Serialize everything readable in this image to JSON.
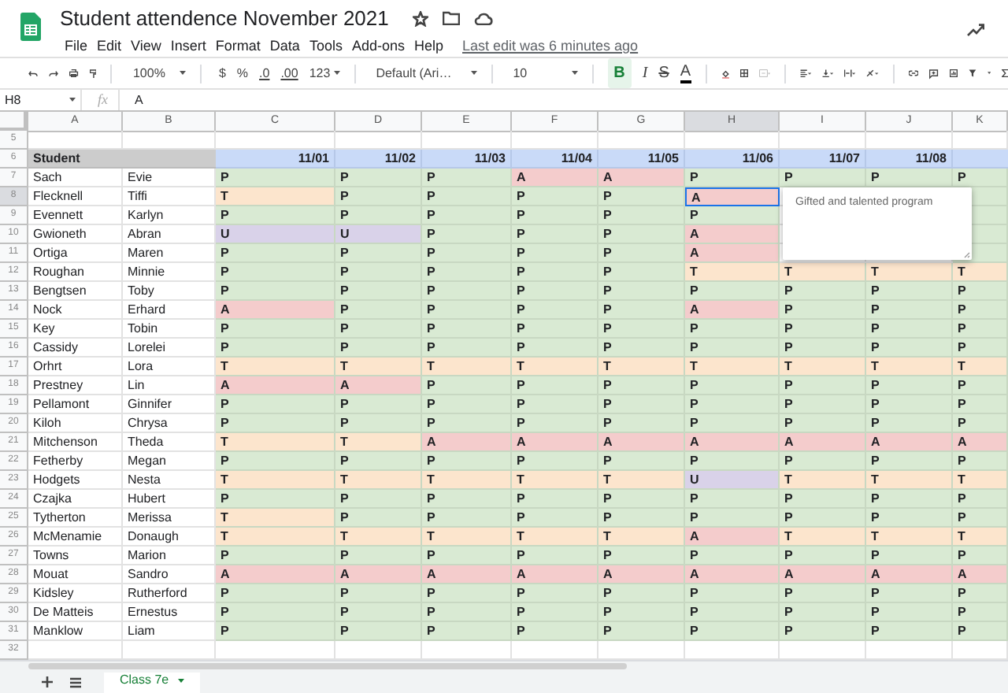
{
  "title": "Student attendence November 2021",
  "menu": [
    "File",
    "Edit",
    "View",
    "Insert",
    "Format",
    "Data",
    "Tools",
    "Add-ons",
    "Help"
  ],
  "last_edit": "Last edit was 6 minutes ago",
  "toolbar": {
    "zoom": "100%",
    "currency": "$",
    "percent": "%",
    "decrease_decimals": ".0",
    "increase_decimals": ".00",
    "number_format": "123",
    "font": "Default (Ari…",
    "font_size": "10",
    "bold": {
      "label": "B",
      "selected": true
    },
    "italic": "I",
    "strikethrough": "S",
    "text_color": "A"
  },
  "formula_bar": {
    "cell": "H8",
    "fx": "fx",
    "value": "A"
  },
  "columns": [
    {
      "label": "A",
      "selected": false
    },
    {
      "label": "B",
      "selected": false
    },
    {
      "label": "C",
      "selected": false
    },
    {
      "label": "D",
      "selected": false
    },
    {
      "label": "E",
      "selected": false
    },
    {
      "label": "F",
      "selected": false
    },
    {
      "label": "G",
      "selected": false
    },
    {
      "label": "H",
      "selected": true
    },
    {
      "label": "I",
      "selected": false
    },
    {
      "label": "J",
      "selected": false
    },
    {
      "label": "K",
      "selected": false
    }
  ],
  "rows": [
    {
      "kind": "blank",
      "number": "5",
      "selected": false
    },
    {
      "kind": "header",
      "number": "6",
      "selected": false,
      "label": "Student",
      "dates": [
        "11/01",
        "11/02",
        "11/03",
        "11/04",
        "11/05",
        "11/06",
        "11/07",
        "11/08"
      ]
    },
    {
      "kind": "student",
      "number": "7",
      "selected": false,
      "last": "Sach",
      "first": "Evie",
      "cells": [
        {
          "value": "P",
          "kind": "present"
        },
        {
          "value": "P",
          "kind": "present"
        },
        {
          "value": "P",
          "kind": "present"
        },
        {
          "value": "A",
          "kind": "absent"
        },
        {
          "value": "A",
          "kind": "absent"
        },
        {
          "value": "P",
          "kind": "present"
        },
        {
          "value": "P",
          "kind": "present"
        },
        {
          "value": "P",
          "kind": "present"
        },
        {
          "value": "P",
          "kind": "present"
        }
      ]
    },
    {
      "kind": "student",
      "number": "8",
      "selected": true,
      "last": "Flecknell",
      "first": "Tiffi",
      "cells": [
        {
          "value": "T",
          "kind": "tardy"
        },
        {
          "value": "P",
          "kind": "present"
        },
        {
          "value": "P",
          "kind": "present"
        },
        {
          "value": "P",
          "kind": "present"
        },
        {
          "value": "P",
          "kind": "present"
        },
        {
          "value": "A",
          "kind": "absent"
        },
        null,
        null,
        {
          "kind": "present"
        }
      ]
    },
    {
      "kind": "student",
      "number": "9",
      "selected": false,
      "last": "Evennett",
      "first": "Karlyn",
      "cells": [
        {
          "value": "P",
          "kind": "present"
        },
        {
          "value": "P",
          "kind": "present"
        },
        {
          "value": "P",
          "kind": "present"
        },
        {
          "value": "P",
          "kind": "present"
        },
        {
          "value": "P",
          "kind": "present"
        },
        {
          "value": "P",
          "kind": "present"
        },
        null,
        null,
        {
          "kind": "present"
        }
      ]
    },
    {
      "kind": "student",
      "number": "10",
      "selected": false,
      "last": "Gwioneth",
      "first": "Abran",
      "cells": [
        {
          "value": "U",
          "kind": "unexcused"
        },
        {
          "value": "U",
          "kind": "unexcused"
        },
        {
          "value": "P",
          "kind": "present"
        },
        {
          "value": "P",
          "kind": "present"
        },
        {
          "value": "P",
          "kind": "present"
        },
        {
          "value": "A",
          "kind": "absent"
        },
        null,
        null,
        {
          "kind": "present"
        }
      ]
    },
    {
      "kind": "student",
      "number": "11",
      "selected": false,
      "last": "Ortiga",
      "first": "Maren",
      "cells": [
        {
          "value": "P",
          "kind": "present"
        },
        {
          "value": "P",
          "kind": "present"
        },
        {
          "value": "P",
          "kind": "present"
        },
        {
          "value": "P",
          "kind": "present"
        },
        {
          "value": "P",
          "kind": "present"
        },
        {
          "value": "A",
          "kind": "absent"
        },
        null,
        null,
        {
          "kind": "present"
        }
      ]
    },
    {
      "kind": "student",
      "number": "12",
      "selected": false,
      "last": "Roughan",
      "first": "Minnie",
      "cells": [
        {
          "value": "P",
          "kind": "present"
        },
        {
          "value": "P",
          "kind": "present"
        },
        {
          "value": "P",
          "kind": "present"
        },
        {
          "value": "P",
          "kind": "present"
        },
        {
          "value": "P",
          "kind": "present"
        },
        {
          "value": "T",
          "kind": "tardy"
        },
        {
          "value": "T",
          "kind": "tardy"
        },
        {
          "value": "T",
          "kind": "tardy"
        },
        {
          "value": "T",
          "kind": "tardy"
        }
      ]
    },
    {
      "kind": "student",
      "number": "13",
      "selected": false,
      "last": "Bengtsen",
      "first": "Toby",
      "cells": [
        {
          "value": "P",
          "kind": "present"
        },
        {
          "value": "P",
          "kind": "present"
        },
        {
          "value": "P",
          "kind": "present"
        },
        {
          "value": "P",
          "kind": "present"
        },
        {
          "value": "P",
          "kind": "present"
        },
        {
          "value": "P",
          "kind": "present"
        },
        {
          "value": "P",
          "kind": "present"
        },
        {
          "value": "P",
          "kind": "present"
        },
        {
          "value": "P",
          "kind": "present"
        }
      ]
    },
    {
      "kind": "student",
      "number": "14",
      "selected": false,
      "last": "Nock",
      "first": "Erhard",
      "cells": [
        {
          "value": "A",
          "kind": "absent"
        },
        {
          "value": "P",
          "kind": "present"
        },
        {
          "value": "P",
          "kind": "present"
        },
        {
          "value": "P",
          "kind": "present"
        },
        {
          "value": "P",
          "kind": "present"
        },
        {
          "value": "A",
          "kind": "absent"
        },
        {
          "value": "P",
          "kind": "present"
        },
        {
          "value": "P",
          "kind": "present"
        },
        {
          "value": "P",
          "kind": "present"
        }
      ]
    },
    {
      "kind": "student",
      "number": "15",
      "selected": false,
      "last": "Key",
      "first": "Tobin",
      "cells": [
        {
          "value": "P",
          "kind": "present"
        },
        {
          "value": "P",
          "kind": "present"
        },
        {
          "value": "P",
          "kind": "present"
        },
        {
          "value": "P",
          "kind": "present"
        },
        {
          "value": "P",
          "kind": "present"
        },
        {
          "value": "P",
          "kind": "present"
        },
        {
          "value": "P",
          "kind": "present"
        },
        {
          "value": "P",
          "kind": "present"
        },
        {
          "value": "P",
          "kind": "present"
        }
      ]
    },
    {
      "kind": "student",
      "number": "16",
      "selected": false,
      "last": "Cassidy",
      "first": "Lorelei",
      "cells": [
        {
          "value": "P",
          "kind": "present"
        },
        {
          "value": "P",
          "kind": "present"
        },
        {
          "value": "P",
          "kind": "present"
        },
        {
          "value": "P",
          "kind": "present"
        },
        {
          "value": "P",
          "kind": "present"
        },
        {
          "value": "P",
          "kind": "present"
        },
        {
          "value": "P",
          "kind": "present"
        },
        {
          "value": "P",
          "kind": "present"
        },
        {
          "value": "P",
          "kind": "present"
        }
      ]
    },
    {
      "kind": "student",
      "number": "17",
      "selected": false,
      "last": "Orhrt",
      "first": "Lora",
      "cells": [
        {
          "value": "T",
          "kind": "tardy"
        },
        {
          "value": "T",
          "kind": "tardy"
        },
        {
          "value": "T",
          "kind": "tardy"
        },
        {
          "value": "T",
          "kind": "tardy"
        },
        {
          "value": "T",
          "kind": "tardy"
        },
        {
          "value": "T",
          "kind": "tardy"
        },
        {
          "value": "T",
          "kind": "tardy"
        },
        {
          "value": "T",
          "kind": "tardy"
        },
        {
          "value": "T",
          "kind": "tardy"
        }
      ]
    },
    {
      "kind": "student",
      "number": "18",
      "selected": false,
      "last": "Prestney",
      "first": "Lin",
      "cells": [
        {
          "value": "A",
          "kind": "absent"
        },
        {
          "value": "A",
          "kind": "absent"
        },
        {
          "value": "P",
          "kind": "present"
        },
        {
          "value": "P",
          "kind": "present"
        },
        {
          "value": "P",
          "kind": "present"
        },
        {
          "value": "P",
          "kind": "present"
        },
        {
          "value": "P",
          "kind": "present"
        },
        {
          "value": "P",
          "kind": "present"
        },
        {
          "value": "P",
          "kind": "present"
        }
      ]
    },
    {
      "kind": "student",
      "number": "19",
      "selected": false,
      "last": "Pellamont",
      "first": "Ginnifer",
      "cells": [
        {
          "value": "P",
          "kind": "present"
        },
        {
          "value": "P",
          "kind": "present"
        },
        {
          "value": "P",
          "kind": "present"
        },
        {
          "value": "P",
          "kind": "present"
        },
        {
          "value": "P",
          "kind": "present"
        },
        {
          "value": "P",
          "kind": "present"
        },
        {
          "value": "P",
          "kind": "present"
        },
        {
          "value": "P",
          "kind": "present"
        },
        {
          "value": "P",
          "kind": "present"
        }
      ]
    },
    {
      "kind": "student",
      "number": "20",
      "selected": false,
      "last": "Kiloh",
      "first": "Chrysa",
      "cells": [
        {
          "value": "P",
          "kind": "present"
        },
        {
          "value": "P",
          "kind": "present"
        },
        {
          "value": "P",
          "kind": "present"
        },
        {
          "value": "P",
          "kind": "present"
        },
        {
          "value": "P",
          "kind": "present"
        },
        {
          "value": "P",
          "kind": "present"
        },
        {
          "value": "P",
          "kind": "present"
        },
        {
          "value": "P",
          "kind": "present"
        },
        {
          "value": "P",
          "kind": "present"
        }
      ]
    },
    {
      "kind": "student",
      "number": "21",
      "selected": false,
      "last": "Mitchenson",
      "first": "Theda",
      "cells": [
        {
          "value": "T",
          "kind": "tardy"
        },
        {
          "value": "T",
          "kind": "tardy"
        },
        {
          "value": "A",
          "kind": "absent"
        },
        {
          "value": "A",
          "kind": "absent"
        },
        {
          "value": "A",
          "kind": "absent"
        },
        {
          "value": "A",
          "kind": "absent"
        },
        {
          "value": "A",
          "kind": "absent"
        },
        {
          "value": "A",
          "kind": "absent"
        },
        {
          "value": "A",
          "kind": "absent"
        }
      ]
    },
    {
      "kind": "student",
      "number": "22",
      "selected": false,
      "last": "Fetherby",
      "first": "Megan",
      "cells": [
        {
          "value": "P",
          "kind": "present"
        },
        {
          "value": "P",
          "kind": "present"
        },
        {
          "value": "P",
          "kind": "present"
        },
        {
          "value": "P",
          "kind": "present"
        },
        {
          "value": "P",
          "kind": "present"
        },
        {
          "value": "P",
          "kind": "present"
        },
        {
          "value": "P",
          "kind": "present"
        },
        {
          "value": "P",
          "kind": "present"
        },
        {
          "value": "P",
          "kind": "present"
        }
      ]
    },
    {
      "kind": "student",
      "number": "23",
      "selected": false,
      "last": "Hodgets",
      "first": "Nesta",
      "cells": [
        {
          "value": "T",
          "kind": "tardy"
        },
        {
          "value": "T",
          "kind": "tardy"
        },
        {
          "value": "T",
          "kind": "tardy"
        },
        {
          "value": "T",
          "kind": "tardy"
        },
        {
          "value": "T",
          "kind": "tardy"
        },
        {
          "value": "U",
          "kind": "unexcused"
        },
        {
          "value": "T",
          "kind": "tardy"
        },
        {
          "value": "T",
          "kind": "tardy"
        },
        {
          "value": "T",
          "kind": "tardy"
        }
      ]
    },
    {
      "kind": "student",
      "number": "24",
      "selected": false,
      "last": "Czajka",
      "first": "Hubert",
      "cells": [
        {
          "value": "P",
          "kind": "present"
        },
        {
          "value": "P",
          "kind": "present"
        },
        {
          "value": "P",
          "kind": "present"
        },
        {
          "value": "P",
          "kind": "present"
        },
        {
          "value": "P",
          "kind": "present"
        },
        {
          "value": "P",
          "kind": "present"
        },
        {
          "value": "P",
          "kind": "present"
        },
        {
          "value": "P",
          "kind": "present"
        },
        {
          "value": "P",
          "kind": "present"
        }
      ]
    },
    {
      "kind": "student",
      "number": "25",
      "selected": false,
      "last": "Tytherton",
      "first": "Merissa",
      "cells": [
        {
          "value": "T",
          "kind": "tardy"
        },
        {
          "value": "P",
          "kind": "present"
        },
        {
          "value": "P",
          "kind": "present"
        },
        {
          "value": "P",
          "kind": "present"
        },
        {
          "value": "P",
          "kind": "present"
        },
        {
          "value": "P",
          "kind": "present"
        },
        {
          "value": "P",
          "kind": "present"
        },
        {
          "value": "P",
          "kind": "present"
        },
        {
          "value": "P",
          "kind": "present"
        }
      ]
    },
    {
      "kind": "student",
      "number": "26",
      "selected": false,
      "last": "McMenamie",
      "first": "Donaugh",
      "cells": [
        {
          "value": "T",
          "kind": "tardy"
        },
        {
          "value": "T",
          "kind": "tardy"
        },
        {
          "value": "T",
          "kind": "tardy"
        },
        {
          "value": "T",
          "kind": "tardy"
        },
        {
          "value": "T",
          "kind": "tardy"
        },
        {
          "value": "A",
          "kind": "absent"
        },
        {
          "value": "T",
          "kind": "tardy"
        },
        {
          "value": "T",
          "kind": "tardy"
        },
        {
          "value": "T",
          "kind": "tardy"
        }
      ]
    },
    {
      "kind": "student",
      "number": "27",
      "selected": false,
      "last": "Towns",
      "first": "Marion",
      "cells": [
        {
          "value": "P",
          "kind": "present"
        },
        {
          "value": "P",
          "kind": "present"
        },
        {
          "value": "P",
          "kind": "present"
        },
        {
          "value": "P",
          "kind": "present"
        },
        {
          "value": "P",
          "kind": "present"
        },
        {
          "value": "P",
          "kind": "present"
        },
        {
          "value": "P",
          "kind": "present"
        },
        {
          "value": "P",
          "kind": "present"
        },
        {
          "value": "P",
          "kind": "present"
        }
      ]
    },
    {
      "kind": "student",
      "number": "28",
      "selected": false,
      "last": "Mouat",
      "first": "Sandro",
      "cells": [
        {
          "value": "A",
          "kind": "absent"
        },
        {
          "value": "A",
          "kind": "absent"
        },
        {
          "value": "A",
          "kind": "absent"
        },
        {
          "value": "A",
          "kind": "absent"
        },
        {
          "value": "A",
          "kind": "absent"
        },
        {
          "value": "A",
          "kind": "absent"
        },
        {
          "value": "A",
          "kind": "absent"
        },
        {
          "value": "A",
          "kind": "absent"
        },
        {
          "value": "A",
          "kind": "absent"
        }
      ]
    },
    {
      "kind": "student",
      "number": "29",
      "selected": false,
      "last": "Kidsley",
      "first": "Rutherford",
      "cells": [
        {
          "value": "P",
          "kind": "present"
        },
        {
          "value": "P",
          "kind": "present"
        },
        {
          "value": "P",
          "kind": "present"
        },
        {
          "value": "P",
          "kind": "present"
        },
        {
          "value": "P",
          "kind": "present"
        },
        {
          "value": "P",
          "kind": "present"
        },
        {
          "value": "P",
          "kind": "present"
        },
        {
          "value": "P",
          "kind": "present"
        },
        {
          "value": "P",
          "kind": "present"
        }
      ]
    },
    {
      "kind": "student",
      "number": "30",
      "selected": false,
      "last": "De Matteis",
      "first": "Ernestus",
      "cells": [
        {
          "value": "P",
          "kind": "present"
        },
        {
          "value": "P",
          "kind": "present"
        },
        {
          "value": "P",
          "kind": "present"
        },
        {
          "value": "P",
          "kind": "present"
        },
        {
          "value": "P",
          "kind": "present"
        },
        {
          "value": "P",
          "kind": "present"
        },
        {
          "value": "P",
          "kind": "present"
        },
        {
          "value": "P",
          "kind": "present"
        },
        {
          "value": "P",
          "kind": "present"
        }
      ]
    },
    {
      "kind": "student",
      "number": "31",
      "selected": false,
      "last": "Manklow",
      "first": "Liam",
      "cells": [
        {
          "value": "P",
          "kind": "present"
        },
        {
          "value": "P",
          "kind": "present"
        },
        {
          "value": "P",
          "kind": "present"
        },
        {
          "value": "P",
          "kind": "present"
        },
        {
          "value": "P",
          "kind": "present"
        },
        {
          "value": "P",
          "kind": "present"
        },
        {
          "value": "P",
          "kind": "present"
        },
        {
          "value": "P",
          "kind": "present"
        },
        {
          "value": "P",
          "kind": "present"
        }
      ]
    },
    {
      "kind": "blank",
      "number": "32",
      "selected": false
    }
  ],
  "comment": {
    "text": "Gifted and talented program"
  },
  "sheets": [
    {
      "label": "Class 7e",
      "selected": true
    }
  ]
}
